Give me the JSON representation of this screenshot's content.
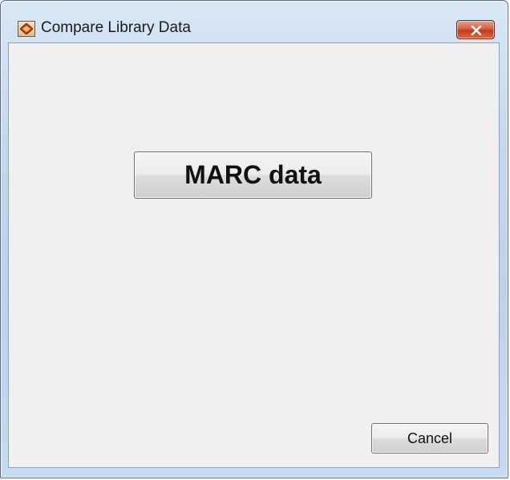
{
  "window": {
    "title": "Compare Library Data",
    "app_icon": "app-diamond-icon",
    "close_icon": "close-icon"
  },
  "dialog": {
    "marc_button_label": "MARC data",
    "cancel_button_label": "Cancel"
  },
  "colors": {
    "close_button": "#c43b1a",
    "client_background": "#f0f0f0",
    "frame": "#bcd2ea"
  }
}
